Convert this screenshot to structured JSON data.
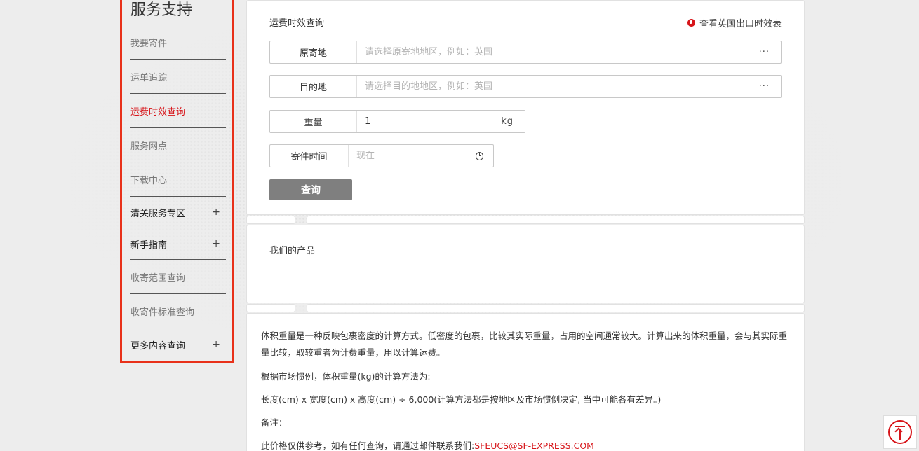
{
  "sidebar": {
    "title": "服务支持",
    "items": [
      {
        "label": "我要寄件"
      },
      {
        "label": "运单追踪"
      },
      {
        "label": "运费时效查询"
      },
      {
        "label": "服务网点"
      },
      {
        "label": "下载中心"
      },
      {
        "label": "清关服务专区",
        "expand": "+"
      },
      {
        "label": "新手指南",
        "expand": "+"
      },
      {
        "label": "收寄范围查询"
      },
      {
        "label": "收寄件标准查询"
      },
      {
        "label": "更多内容查询",
        "expand": "+"
      }
    ],
    "active_index": 2
  },
  "query_panel": {
    "title": "运费时效查询",
    "uk_link": "查看英国出口时效表",
    "origin": {
      "label": "原寄地",
      "placeholder": "请选择原寄地地区，例如：英国",
      "suffix": "···"
    },
    "destination": {
      "label": "目的地",
      "placeholder": "请选择目的地地区，例如：英国",
      "suffix": "···"
    },
    "weight": {
      "label": "重量",
      "value": "1",
      "unit": "kg"
    },
    "send_time": {
      "label": "寄件时间",
      "placeholder": "现在"
    },
    "submit_label": "查询"
  },
  "products_panel": {
    "title": "我们的产品"
  },
  "info_panel": {
    "para1": "体积重量是一种反映包裹密度的计算方式。低密度的包裹，比较其实际重量，占用的空间通常较大。计算出来的体积重量，会与其实际重量比较，取较重者为计费重量，用以计算运费。",
    "para2": "根据市场惯例，体积重量(kg)的计算方法为:",
    "para3": "长度(cm) x 宽度(cm) x 高度(cm) ÷ 6,000(计算方法都是按地区及市场惯例决定, 当中可能各有差异。)",
    "para4": "备注：",
    "para5_prefix": "此价格仅供参考，如有任何查询，请通过邮件联系我们:",
    "email": "SFEUCS@SF-EXPRESS.COM"
  },
  "colors": {
    "accent": "#d7151a",
    "highlight_border": "#e8311a",
    "button_bg": "#7f7f7f"
  }
}
